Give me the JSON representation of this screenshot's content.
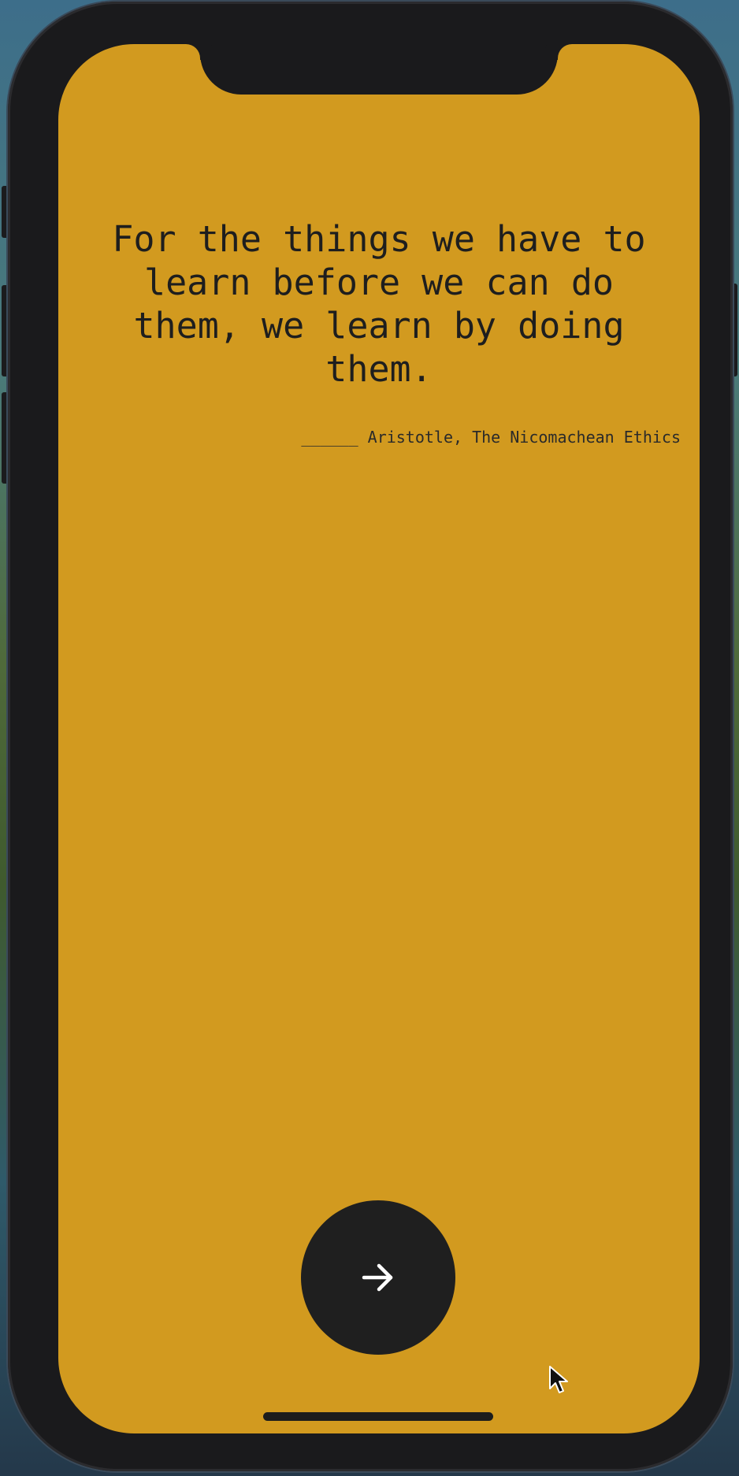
{
  "quote": {
    "text": "For the things we have to learn before we can do them, we learn by doing them.",
    "attribution": "______ Aristotle, The Nicomachean Ethics"
  },
  "controls": {
    "next_icon": "arrow-right-icon"
  },
  "colors": {
    "background": "#d29a1f",
    "text": "#1e1e1e",
    "button": "#1f1f1f",
    "button_icon": "#ffffff",
    "frame": "#1a1a1c"
  }
}
